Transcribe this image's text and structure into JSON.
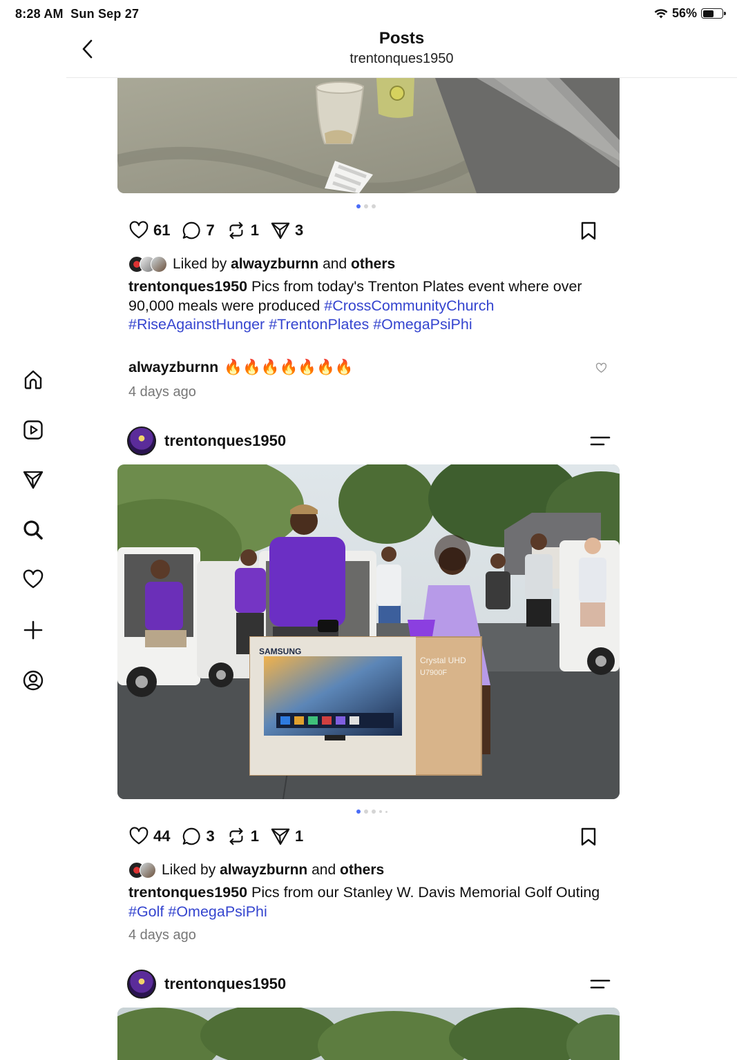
{
  "status_bar": {
    "time": "8:28 AM",
    "date": "Sun Sep 27",
    "battery": "56%",
    "battery_level": 0.56
  },
  "header": {
    "title": "Posts",
    "subtitle": "trentonques1950",
    "back_icon": "chevron-left-icon"
  },
  "sidebar": {
    "items": [
      {
        "icon": "home-icon"
      },
      {
        "icon": "video-icon"
      },
      {
        "icon": "send-icon"
      },
      {
        "icon": "search-icon"
      },
      {
        "icon": "heart-icon"
      },
      {
        "icon": "plus-icon"
      },
      {
        "icon": "profile-icon"
      }
    ]
  },
  "post1": {
    "likes": "61",
    "comments": "7",
    "reposts": "1",
    "shares": "3",
    "carousel_total": 3,
    "carousel_active": 1,
    "liked_by_prefix": "Liked by",
    "liked_by_user": "alwayzburnn",
    "liked_by_and": "and",
    "liked_by_others": "others",
    "caption_user": "trentonques1950",
    "caption_text": "Pics from today's Trenton Plates event where over 90,000 meals were produced",
    "hashtags": [
      "#CrossCommunityChurch",
      "#RiseAgainstHunger",
      "#TrentonPlates",
      "#OmegaPsiPhi"
    ],
    "comment_user": "alwayzburnn",
    "comment_text": "🔥🔥🔥🔥🔥🔥🔥",
    "timestamp": "4 days ago"
  },
  "post2": {
    "username": "trentonques1950",
    "image_texts": {
      "brand": "SAMSUNG",
      "product": "Crystal UHD",
      "model": "U7900F"
    },
    "likes": "44",
    "comments": "3",
    "reposts": "1",
    "shares": "1",
    "carousel_total": 5,
    "carousel_active": 1,
    "liked_by_prefix": "Liked by",
    "liked_by_user": "alwayzburnn",
    "liked_by_and": "and",
    "liked_by_others": "others",
    "caption_user": "trentonques1950",
    "caption_text": "Pics from our Stanley W. Davis Memorial Golf Outing",
    "hashtags": [
      "#Golf",
      "#OmegaPsiPhi"
    ],
    "timestamp": "4 days ago"
  },
  "post3": {
    "username": "trentonques1950"
  },
  "colors": {
    "hashtag": "#3545cf",
    "dot_active": "#4a6cf7",
    "text": "#111111",
    "muted": "#777777"
  }
}
